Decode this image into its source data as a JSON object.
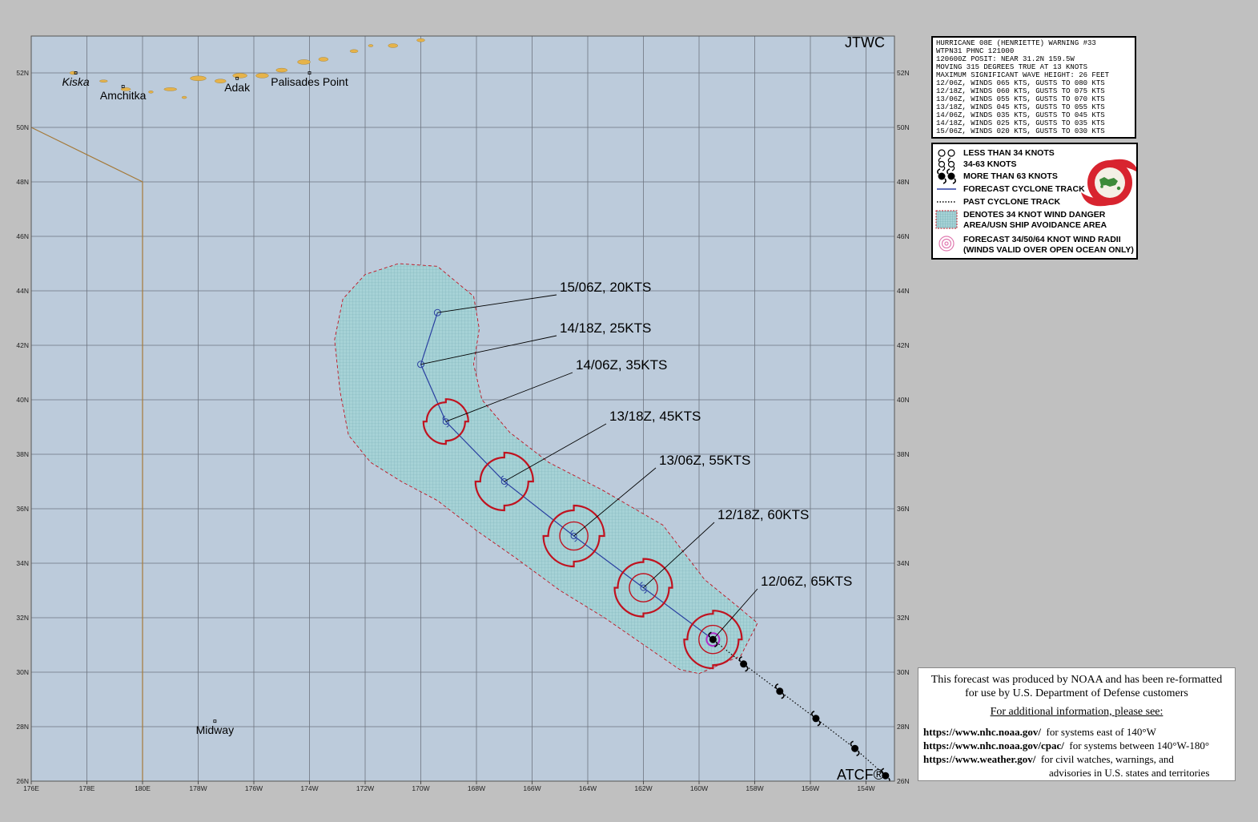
{
  "header": {
    "agency": "JTWC",
    "mark": "ATCF®"
  },
  "warning": {
    "lines": [
      "HURRICANE 08E (HENRIETTE) WARNING #33",
      "WTPN31 PHNC 121000",
      "120600Z POSIT: NEAR 31.2N 159.5W",
      "MOVING 315 DEGREES TRUE AT 13 KNOTS",
      "MAXIMUM SIGNIFICANT WAVE HEIGHT: 26 FEET",
      "12/06Z, WINDS 065 KTS, GUSTS TO 080 KTS",
      "12/18Z, WINDS 060 KTS, GUSTS TO 075 KTS",
      "13/06Z, WINDS 055 KTS, GUSTS TO 070 KTS",
      "13/18Z, WINDS 045 KTS, GUSTS TO 055 KTS",
      "14/06Z, WINDS 035 KTS, GUSTS TO 045 KTS",
      "14/18Z, WINDS 025 KTS, GUSTS TO 035 KTS",
      "15/06Z, WINDS 020 KTS, GUSTS TO 030 KTS"
    ]
  },
  "legend": {
    "items": [
      {
        "label": "LESS THAN 34 KNOTS",
        "icon": "open-circle-icon"
      },
      {
        "label": "34-63 KNOTS",
        "icon": "storm-symbol-icon"
      },
      {
        "label": "MORE THAN 63 KNOTS",
        "icon": "hurricane-symbol-icon"
      },
      {
        "label": "FORECAST CYCLONE TRACK",
        "icon": "solid-line-icon"
      },
      {
        "label": "PAST CYCLONE TRACK",
        "icon": "dotted-line-icon"
      },
      {
        "label": "DENOTES 34 KNOT WIND DANGER",
        "icon": "hatched-area-icon"
      },
      {
        "label": "AREA/USN SHIP AVOIDANCE AREA",
        "icon": ""
      },
      {
        "label": "FORECAST 34/50/64 KNOT WIND RADII",
        "icon": "wind-radii-icon"
      },
      {
        "label": "(WINDS VALID OVER OPEN OCEAN ONLY)",
        "icon": ""
      }
    ]
  },
  "info": {
    "line1": "This forecast was produced by NOAA and has been re-formatted",
    "line2": "for use by U.S. Department of Defense customers",
    "line3": "For additional information, please see:",
    "link1_url": "https://www.nhc.noaa.gov/",
    "link1_desc": "for systems east of 140°W",
    "link2_url": "https://www.nhc.noaa.gov/cpac/",
    "link2_desc": "for systems between 140°W-180°",
    "link3_url": "https://www.weather.gov/",
    "link3_desc": "for civil watches, warnings, and",
    "link3_desc2": "advisories in U.S. states and territories"
  },
  "map": {
    "lon_range": [
      176,
      208
    ],
    "lat_range": [
      26,
      53.5
    ],
    "lon_labels": [
      "176E",
      "178E",
      "180E",
      "178W",
      "176W",
      "174W",
      "172W",
      "170W",
      "168W",
      "166W",
      "164W",
      "162W",
      "160W",
      "158W",
      "156W",
      "154W"
    ],
    "lat_labels": [
      "26N",
      "28N",
      "30N",
      "32N",
      "34N",
      "36N",
      "38N",
      "40N",
      "42N",
      "44N",
      "46N",
      "48N",
      "50N",
      "52N"
    ],
    "places": [
      {
        "name": "Kiska",
        "lon": 177.6,
        "lat": 52.0,
        "italic": true
      },
      {
        "name": "Amchitka",
        "lon": 179.3,
        "lat": 51.5,
        "italic": false
      },
      {
        "name": "Adak",
        "lon": 183.4,
        "lat": 51.8,
        "italic": false
      },
      {
        "name": "Palisades Point",
        "lon": 186.0,
        "lat": 52.0,
        "italic": false
      },
      {
        "name": "Midway",
        "lon": 182.6,
        "lat": 28.2,
        "italic": false
      }
    ],
    "forecast": [
      {
        "label": "12/06Z,  65KTS",
        "lon": 200.5,
        "lat": 31.2,
        "intensity": "hurricane"
      },
      {
        "label": "12/18Z,  60KTS",
        "lon": 198.0,
        "lat": 33.1,
        "intensity": "storm"
      },
      {
        "label": "13/06Z,  55KTS",
        "lon": 195.5,
        "lat": 35.0,
        "intensity": "storm"
      },
      {
        "label": "13/18Z,  45KTS",
        "lon": 193.0,
        "lat": 37.0,
        "intensity": "storm"
      },
      {
        "label": "14/06Z,  35KTS",
        "lon": 190.9,
        "lat": 39.2,
        "intensity": "storm"
      },
      {
        "label": "14/18Z,  25KTS",
        "lon": 190.0,
        "lat": 41.3,
        "intensity": "depression"
      },
      {
        "label": "15/06Z,  20KTS",
        "lon": 190.6,
        "lat": 43.2,
        "intensity": "depression"
      }
    ],
    "past_track": [
      {
        "lon": 201.6,
        "lat": 30.3
      },
      {
        "lon": 202.9,
        "lat": 29.3
      },
      {
        "lon": 204.2,
        "lat": 28.3
      },
      {
        "lon": 205.6,
        "lat": 27.2
      },
      {
        "lon": 206.7,
        "lat": 26.2
      }
    ],
    "colors": {
      "ocean": "#bccbdb",
      "land": "#e6b34a",
      "grid": "#6e7580",
      "danger": "#a6d2d6",
      "radii": "#c0121f",
      "track": "#2a3fa0"
    }
  }
}
